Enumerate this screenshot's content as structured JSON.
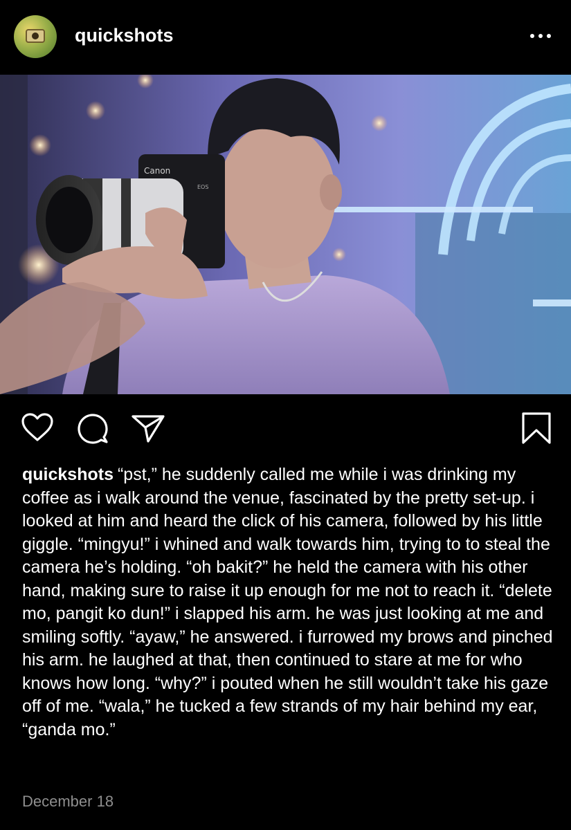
{
  "post": {
    "username": "quickshots",
    "caption_username": "quickshots",
    "caption": "“pst,” he suddenly called me while i was drinking my coffee as i walk around the venue, fascinated by the pretty set-up. i looked at him and heard the click of his camera, followed by his little giggle. “mingyu!” i whined and walk towards him, trying to to steal the camera he’s holding. “oh bakit?” he held the camera with his other hand, making sure to raise it up enough for me not to reach it. “delete mo, pangit ko dun!” i slapped his arm. he was just looking at me and smiling softly. “ayaw,” he answered. i furrowed my brows and pinched his arm. he laughed at that, then continued to stare at me for who knows how long. “why?” i pouted when he still wouldn’t take his gaze off of me. “wala,” he tucked a few strands of my hair behind my ear, “ganda mo.”",
    "date": "December 18"
  },
  "photo": {
    "camera_brand": "Canon",
    "camera_model": "EOS"
  },
  "icons": {
    "avatar": "camera-avatar",
    "more": "more-dots-icon",
    "like": "heart-icon",
    "comment": "comment-bubble-icon",
    "share": "paper-plane-icon",
    "save": "bookmark-icon"
  },
  "colors": {
    "background": "#000000",
    "text": "#ffffff",
    "date": "#8e8e8e"
  }
}
